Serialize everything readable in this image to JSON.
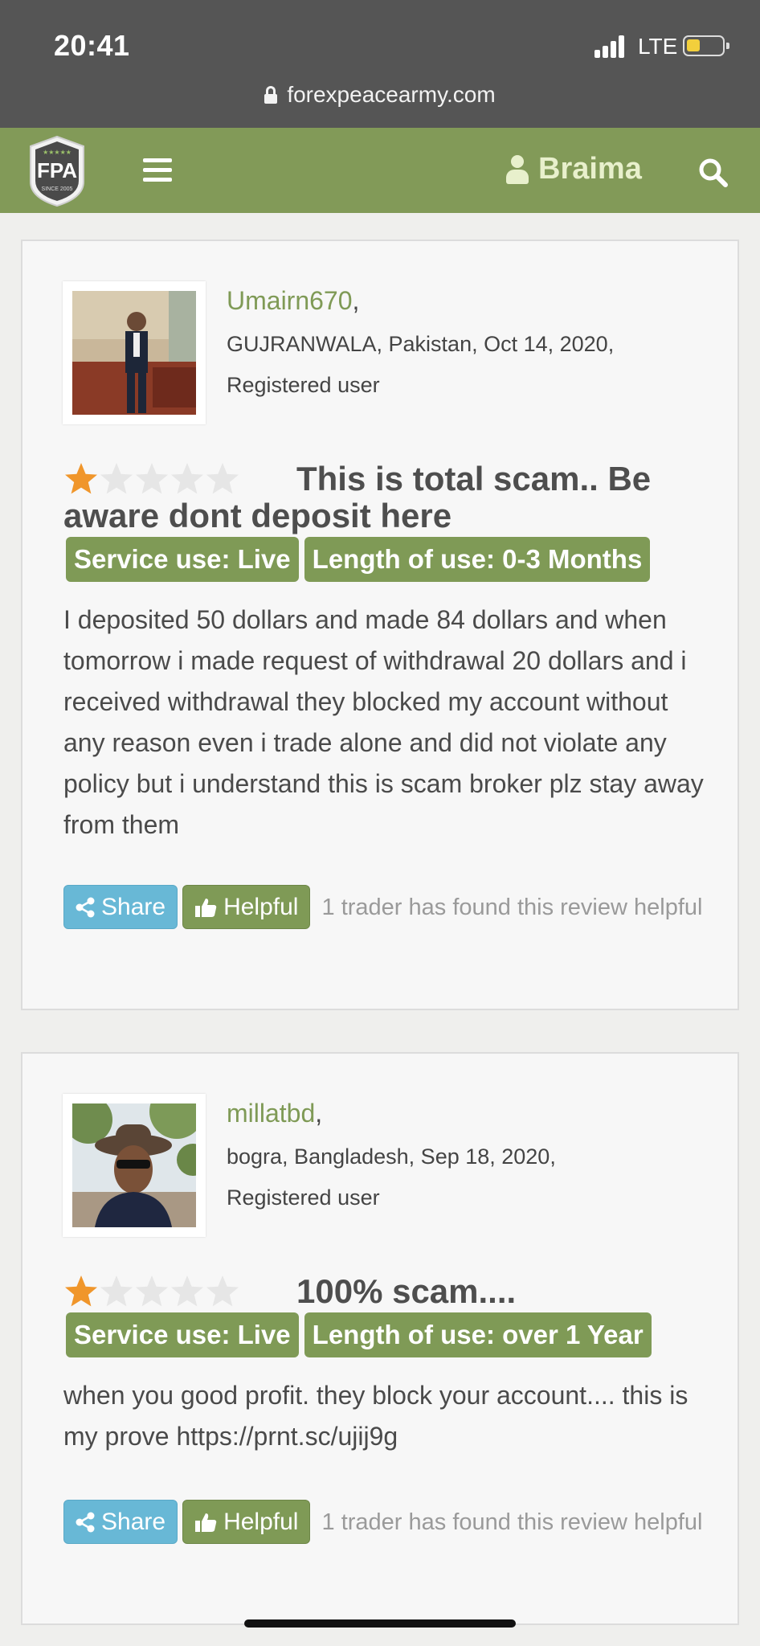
{
  "status_bar": {
    "time": "20:41",
    "network": "LTE"
  },
  "browser": {
    "url": "forexpeacearmy.com"
  },
  "nav": {
    "logo": {
      "line1": "FPA",
      "line2": "SINCE 2005"
    },
    "user_name": "Braima"
  },
  "reviews": [
    {
      "username": "Umairn670",
      "location": "GUJRANWALA, Pakistan, Oct 14, 2020,",
      "role": "Registered user",
      "rating": 1,
      "title": "This is total scam.. Be aware dont deposit here",
      "service_use": "Service use: Live",
      "length_of_use": "Length of use: 0-3 Months",
      "body": "I deposited 50 dollars and made 84 dollars and when tomorrow i made request of withdrawal 20 dollars and i received withdrawal they blocked my account without any reason even i trade alone and did not violate any policy but i understand this is scam broker plz stay away from them",
      "share_label": "Share",
      "helpful_label": "Helpful",
      "helpful_text": "1 trader has found this review helpful"
    },
    {
      "username": "millatbd",
      "location": "bogra, Bangladesh, Sep 18, 2020,",
      "role": "Registered user",
      "rating": 1,
      "title": "100% scam....",
      "service_use": "Service use: Live",
      "length_of_use": "Length of use: over 1 Year",
      "body": "when you good profit. they block your account.... this is my prove https://prnt.sc/ujij9g",
      "share_label": "Share",
      "helpful_label": "Helpful",
      "helpful_text": "1 trader has found this review helpful"
    }
  ],
  "colors": {
    "brand_green": "#829a58",
    "share_blue": "#68b8d6",
    "star_orange": "#f0962b",
    "star_empty": "#e6e6e6"
  },
  "icons": [
    "lock-icon",
    "signal-icon",
    "battery-icon",
    "menu-icon",
    "user-icon",
    "search-icon",
    "star-icon",
    "share-icon",
    "thumbs-up-icon"
  ]
}
